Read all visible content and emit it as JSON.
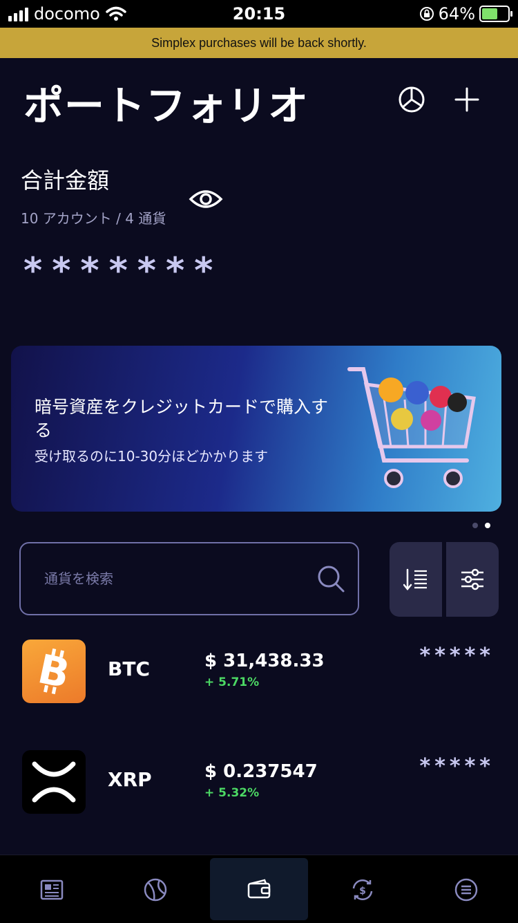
{
  "status_bar": {
    "carrier": "docomo",
    "time": "20:15",
    "battery": "64%"
  },
  "notice": "Simplex purchases will be back shortly.",
  "header": {
    "title": "ポートフォリオ"
  },
  "summary": {
    "label": "合計金額",
    "accounts": "10 アカウント / 4 通貨",
    "hidden_total": "*******"
  },
  "promo": {
    "title": "暗号資産をクレジットカードで購入する",
    "subtitle": "受け取るのに10-30分ほどかかります"
  },
  "search": {
    "placeholder": "通貨を検索"
  },
  "coins": [
    {
      "symbol": "BTC",
      "price": "$ 31,438.33",
      "change": "+ 5.71%",
      "balance": "*****",
      "icon": "bitcoin-icon",
      "color": "#f7931a"
    },
    {
      "symbol": "XRP",
      "price": "$ 0.237547",
      "change": "+ 5.32%",
      "balance": "*****",
      "icon": "xrp-icon",
      "color": "#000000"
    }
  ],
  "tabs": [
    {
      "icon": "news-icon"
    },
    {
      "icon": "markets-icon"
    },
    {
      "icon": "wallet-icon",
      "active": true
    },
    {
      "icon": "exchange-icon"
    },
    {
      "icon": "menu-icon"
    }
  ],
  "colors": {
    "background": "#0b0b1f",
    "banner": "#c7a53a",
    "positive": "#4cd964",
    "hidden_text": "#c8c8f0"
  }
}
